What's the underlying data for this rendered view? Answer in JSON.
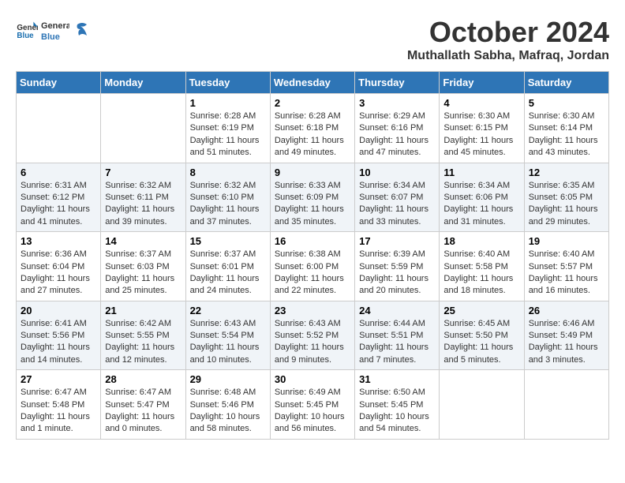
{
  "header": {
    "logo_general": "General",
    "logo_blue": "Blue",
    "month": "October 2024",
    "location": "Muthallath Sabha, Mafraq, Jordan"
  },
  "weekdays": [
    "Sunday",
    "Monday",
    "Tuesday",
    "Wednesday",
    "Thursday",
    "Friday",
    "Saturday"
  ],
  "weeks": [
    [
      {
        "day": "",
        "info": ""
      },
      {
        "day": "",
        "info": ""
      },
      {
        "day": "1",
        "info": "Sunrise: 6:28 AM\nSunset: 6:19 PM\nDaylight: 11 hours and 51 minutes."
      },
      {
        "day": "2",
        "info": "Sunrise: 6:28 AM\nSunset: 6:18 PM\nDaylight: 11 hours and 49 minutes."
      },
      {
        "day": "3",
        "info": "Sunrise: 6:29 AM\nSunset: 6:16 PM\nDaylight: 11 hours and 47 minutes."
      },
      {
        "day": "4",
        "info": "Sunrise: 6:30 AM\nSunset: 6:15 PM\nDaylight: 11 hours and 45 minutes."
      },
      {
        "day": "5",
        "info": "Sunrise: 6:30 AM\nSunset: 6:14 PM\nDaylight: 11 hours and 43 minutes."
      }
    ],
    [
      {
        "day": "6",
        "info": "Sunrise: 6:31 AM\nSunset: 6:12 PM\nDaylight: 11 hours and 41 minutes."
      },
      {
        "day": "7",
        "info": "Sunrise: 6:32 AM\nSunset: 6:11 PM\nDaylight: 11 hours and 39 minutes."
      },
      {
        "day": "8",
        "info": "Sunrise: 6:32 AM\nSunset: 6:10 PM\nDaylight: 11 hours and 37 minutes."
      },
      {
        "day": "9",
        "info": "Sunrise: 6:33 AM\nSunset: 6:09 PM\nDaylight: 11 hours and 35 minutes."
      },
      {
        "day": "10",
        "info": "Sunrise: 6:34 AM\nSunset: 6:07 PM\nDaylight: 11 hours and 33 minutes."
      },
      {
        "day": "11",
        "info": "Sunrise: 6:34 AM\nSunset: 6:06 PM\nDaylight: 11 hours and 31 minutes."
      },
      {
        "day": "12",
        "info": "Sunrise: 6:35 AM\nSunset: 6:05 PM\nDaylight: 11 hours and 29 minutes."
      }
    ],
    [
      {
        "day": "13",
        "info": "Sunrise: 6:36 AM\nSunset: 6:04 PM\nDaylight: 11 hours and 27 minutes."
      },
      {
        "day": "14",
        "info": "Sunrise: 6:37 AM\nSunset: 6:03 PM\nDaylight: 11 hours and 25 minutes."
      },
      {
        "day": "15",
        "info": "Sunrise: 6:37 AM\nSunset: 6:01 PM\nDaylight: 11 hours and 24 minutes."
      },
      {
        "day": "16",
        "info": "Sunrise: 6:38 AM\nSunset: 6:00 PM\nDaylight: 11 hours and 22 minutes."
      },
      {
        "day": "17",
        "info": "Sunrise: 6:39 AM\nSunset: 5:59 PM\nDaylight: 11 hours and 20 minutes."
      },
      {
        "day": "18",
        "info": "Sunrise: 6:40 AM\nSunset: 5:58 PM\nDaylight: 11 hours and 18 minutes."
      },
      {
        "day": "19",
        "info": "Sunrise: 6:40 AM\nSunset: 5:57 PM\nDaylight: 11 hours and 16 minutes."
      }
    ],
    [
      {
        "day": "20",
        "info": "Sunrise: 6:41 AM\nSunset: 5:56 PM\nDaylight: 11 hours and 14 minutes."
      },
      {
        "day": "21",
        "info": "Sunrise: 6:42 AM\nSunset: 5:55 PM\nDaylight: 11 hours and 12 minutes."
      },
      {
        "day": "22",
        "info": "Sunrise: 6:43 AM\nSunset: 5:54 PM\nDaylight: 11 hours and 10 minutes."
      },
      {
        "day": "23",
        "info": "Sunrise: 6:43 AM\nSunset: 5:52 PM\nDaylight: 11 hours and 9 minutes."
      },
      {
        "day": "24",
        "info": "Sunrise: 6:44 AM\nSunset: 5:51 PM\nDaylight: 11 hours and 7 minutes."
      },
      {
        "day": "25",
        "info": "Sunrise: 6:45 AM\nSunset: 5:50 PM\nDaylight: 11 hours and 5 minutes."
      },
      {
        "day": "26",
        "info": "Sunrise: 6:46 AM\nSunset: 5:49 PM\nDaylight: 11 hours and 3 minutes."
      }
    ],
    [
      {
        "day": "27",
        "info": "Sunrise: 6:47 AM\nSunset: 5:48 PM\nDaylight: 11 hours and 1 minute."
      },
      {
        "day": "28",
        "info": "Sunrise: 6:47 AM\nSunset: 5:47 PM\nDaylight: 11 hours and 0 minutes."
      },
      {
        "day": "29",
        "info": "Sunrise: 6:48 AM\nSunset: 5:46 PM\nDaylight: 10 hours and 58 minutes."
      },
      {
        "day": "30",
        "info": "Sunrise: 6:49 AM\nSunset: 5:45 PM\nDaylight: 10 hours and 56 minutes."
      },
      {
        "day": "31",
        "info": "Sunrise: 6:50 AM\nSunset: 5:45 PM\nDaylight: 10 hours and 54 minutes."
      },
      {
        "day": "",
        "info": ""
      },
      {
        "day": "",
        "info": ""
      }
    ]
  ]
}
